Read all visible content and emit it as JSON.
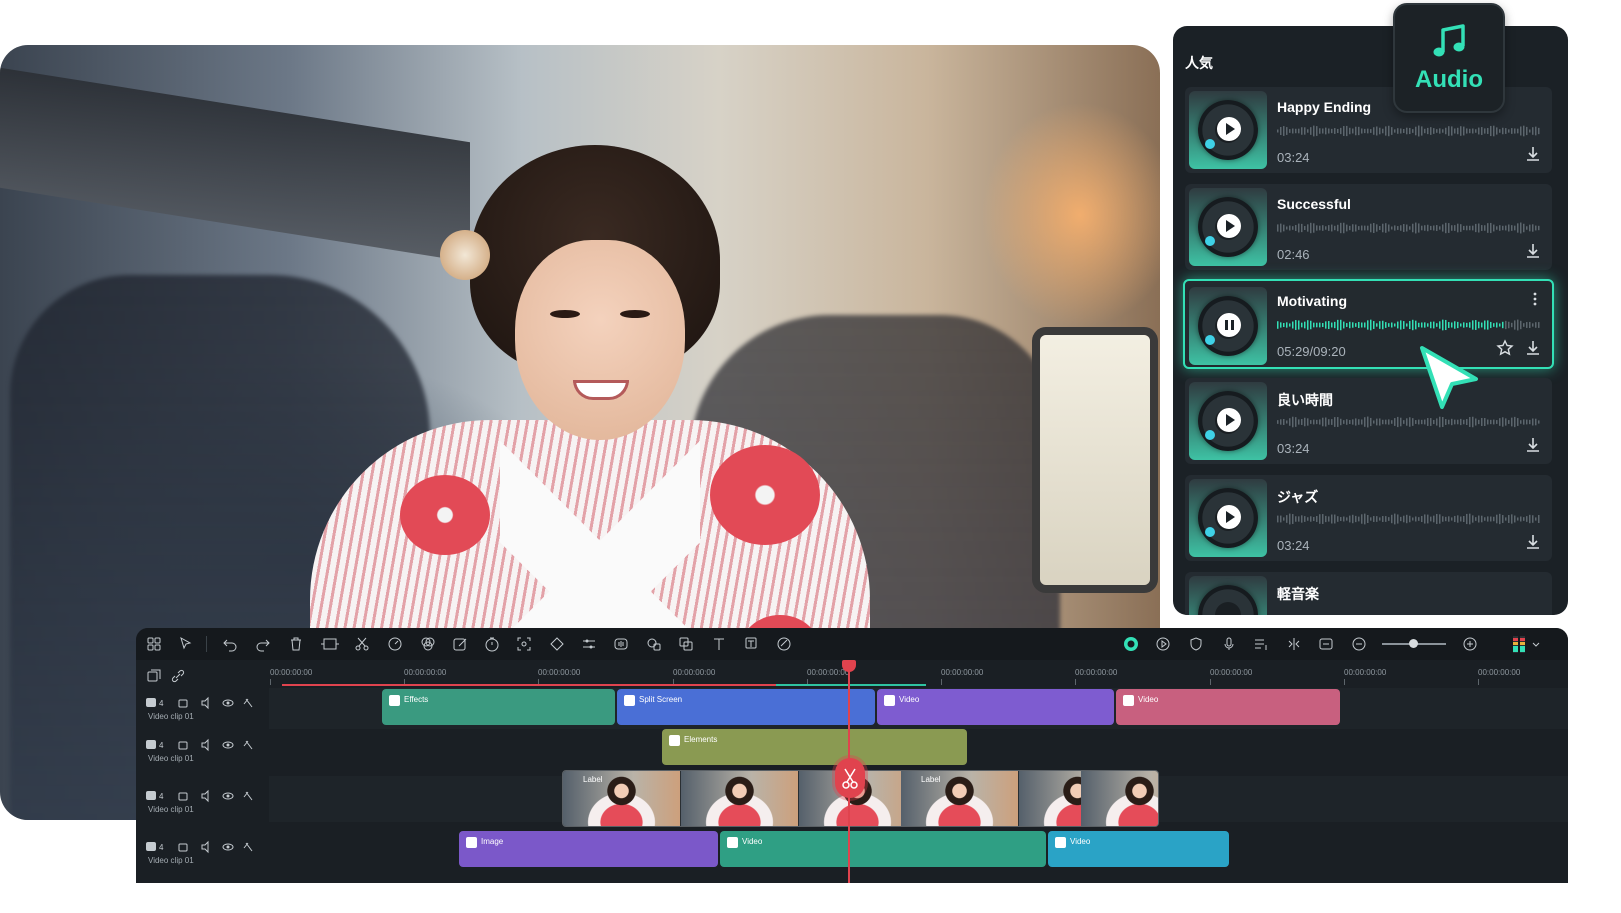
{
  "audio_panel": {
    "title": "人気",
    "badge_label": "Audio",
    "tracks": [
      {
        "name": "Happy Ending",
        "time": "03:24",
        "state": "idle"
      },
      {
        "name": "Successful",
        "time": "02:46",
        "state": "idle"
      },
      {
        "name": "Motivating",
        "time": "05:29/09:20",
        "state": "playing"
      },
      {
        "name": "良い時間",
        "time": "03:24",
        "state": "idle"
      },
      {
        "name": "ジャズ",
        "time": "03:24",
        "state": "idle"
      },
      {
        "name": "軽音楽",
        "time": "",
        "state": "idle"
      }
    ],
    "accent_color": "#33e0b6"
  },
  "timeline": {
    "ruler_labels": [
      "00:00:00:00",
      "00:00:00:00",
      "00:00:00:00",
      "00:00:00:00",
      "00:00:00:00",
      "00:00:00:00",
      "00:00:00:00",
      "00:00:00:00",
      "00:00:00:00",
      "00:00:00:00"
    ],
    "track_heads": [
      {
        "count": "4",
        "name": "Video clip 01"
      },
      {
        "count": "4",
        "name": "Video clip 01"
      },
      {
        "count": "4",
        "name": "Video clip 01"
      },
      {
        "count": "4",
        "name": "Video clip 01"
      }
    ],
    "clips": {
      "effects": "Effects",
      "split_screen": "Split Screen",
      "video_a": "Video",
      "video_b": "Video",
      "elements": "Elements",
      "image": "Image",
      "video_c": "Video",
      "video_d": "Video"
    },
    "filmstrip_labels": [
      "Label",
      "Label"
    ],
    "clip_colors": {
      "effects": "#3a9a80",
      "split_screen": "#4a6fd6",
      "video_purple": "#7e5cd0",
      "video_pink": "#c8607f",
      "elements": "#8a9a52",
      "image": "#7b58c9",
      "video_green": "#2f9f84",
      "video_blue": "#2aa3c6"
    },
    "playhead_color": "#e0434e"
  }
}
